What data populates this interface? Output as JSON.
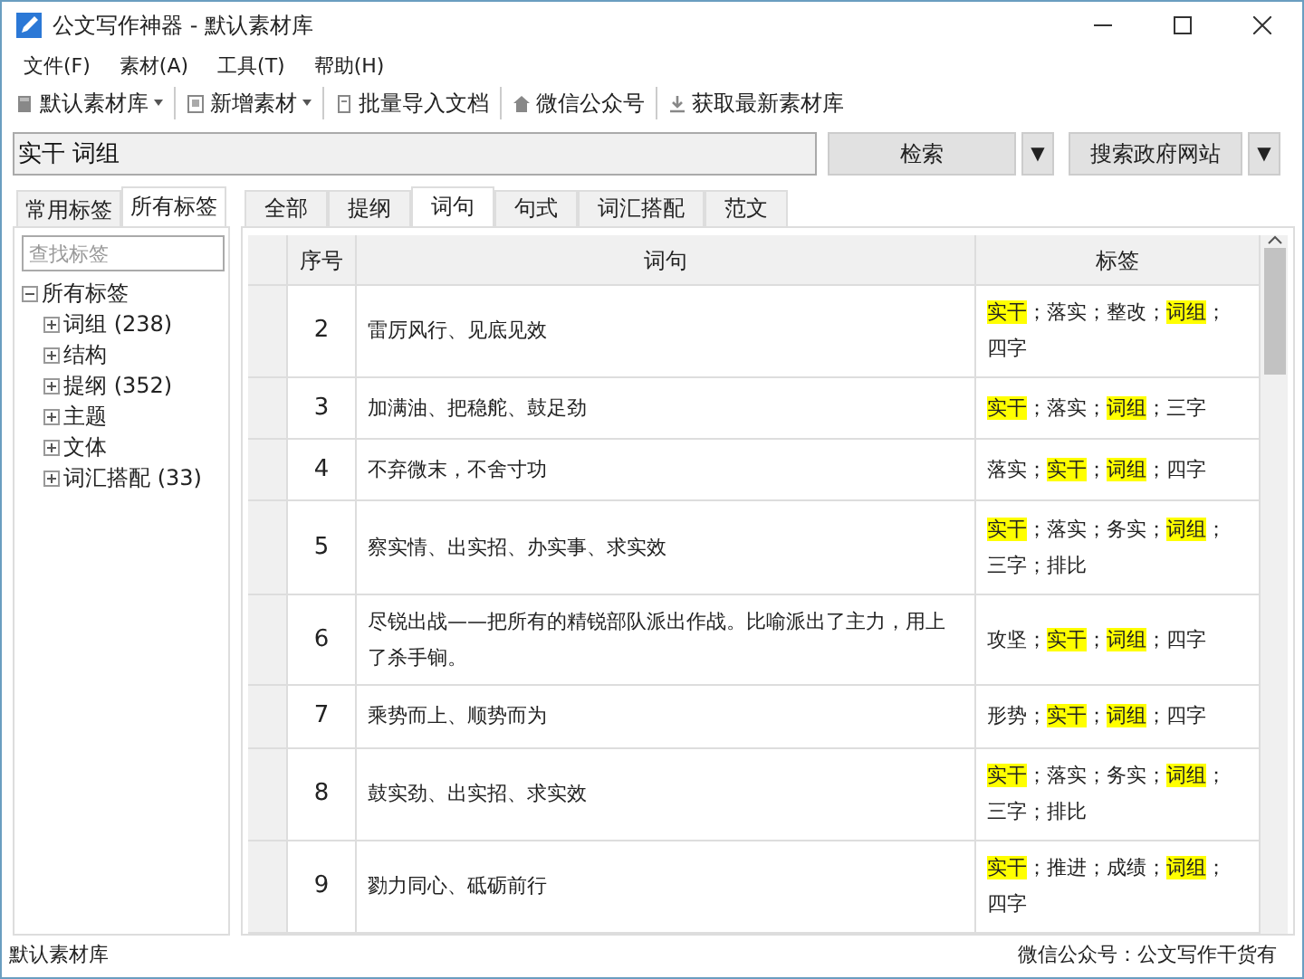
{
  "window": {
    "title": "公文写作神器 - 默认素材库"
  },
  "menu": [
    {
      "label": "文件(F)"
    },
    {
      "label": "素材(A)"
    },
    {
      "label": "工具(T)"
    },
    {
      "label": "帮助(H)"
    }
  ],
  "toolbar": [
    {
      "label": "默认素材库",
      "kind": "library",
      "dropdown": true
    },
    {
      "label": "新增素材",
      "kind": "add",
      "dropdown": true
    },
    {
      "label": "批量导入文档",
      "kind": "import",
      "dropdown": false
    },
    {
      "label": "微信公众号",
      "kind": "home",
      "dropdown": false
    },
    {
      "label": "获取最新素材库",
      "kind": "download",
      "dropdown": false
    }
  ],
  "search": {
    "value": "实干 词组",
    "buttons": [
      {
        "label": "检索",
        "arrow": "▼"
      },
      {
        "label": "搜索政府网站",
        "arrow": "▼"
      }
    ]
  },
  "tag_panel": {
    "tabs": [
      {
        "label": "常用标签",
        "selected": false
      },
      {
        "label": "所有标签",
        "selected": true
      }
    ],
    "filter": {
      "placeholder": "查找标签"
    },
    "tree": {
      "label": "所有标签",
      "expanded": true,
      "children": [
        {
          "label": "词组",
          "count": "(238)",
          "expanded": false
        },
        {
          "label": "结构",
          "expanded": false
        },
        {
          "label": "提纲",
          "count": "(352)",
          "expanded": false
        },
        {
          "label": "主题",
          "expanded": false
        },
        {
          "label": "文体",
          "expanded": false
        },
        {
          "label": "词汇搭配",
          "count": "(33)",
          "expanded": false
        }
      ]
    }
  },
  "content_tabs": [
    {
      "label": "全部",
      "selected": false
    },
    {
      "label": "提纲",
      "selected": false
    },
    {
      "label": "词句",
      "selected": true
    },
    {
      "label": "句式",
      "selected": false
    },
    {
      "label": "词汇搭配",
      "selected": false
    },
    {
      "label": "范文",
      "selected": false
    }
  ],
  "table": {
    "columns": [
      "序号",
      "词句",
      "标签"
    ],
    "separator": "；",
    "rows": [
      {
        "number": "2",
        "text": "雷厉风行、见底见效",
        "tags": [
          {
            "text": "实干",
            "highlighted": true
          },
          {
            "text": "落实",
            "highlighted": false
          },
          {
            "text": "整改",
            "highlighted": false
          },
          {
            "text": "词组",
            "highlighted": true
          },
          {
            "text": "四字",
            "highlighted": false
          }
        ]
      },
      {
        "number": "3",
        "text": "加满油、把稳舵、鼓足劲",
        "tags": [
          {
            "text": "实干",
            "highlighted": true
          },
          {
            "text": "落实",
            "highlighted": false
          },
          {
            "text": "词组",
            "highlighted": true
          },
          {
            "text": "三字",
            "highlighted": false
          }
        ]
      },
      {
        "number": "4",
        "text": "不弃微末，不舍寸功",
        "tags": [
          {
            "text": "落实",
            "highlighted": false
          },
          {
            "text": "实干",
            "highlighted": true
          },
          {
            "text": "词组",
            "highlighted": true
          },
          {
            "text": "四字",
            "highlighted": false
          }
        ]
      },
      {
        "number": "5",
        "text": "察实情、出实招、办实事、求实效",
        "tags": [
          {
            "text": "实干",
            "highlighted": true
          },
          {
            "text": "落实",
            "highlighted": false
          },
          {
            "text": "务实",
            "highlighted": false
          },
          {
            "text": "词组",
            "highlighted": true
          },
          {
            "text": "三字",
            "highlighted": false
          },
          {
            "text": "排比",
            "highlighted": false
          }
        ]
      },
      {
        "number": "6",
        "text": "尽锐出战——把所有的精锐部队派出作战。比喻派出了主力，用上了杀手锏。",
        "tags": [
          {
            "text": "攻坚",
            "highlighted": false
          },
          {
            "text": "实干",
            "highlighted": true
          },
          {
            "text": "词组",
            "highlighted": true
          },
          {
            "text": "四字",
            "highlighted": false
          }
        ]
      },
      {
        "number": "7",
        "text": "乘势而上、顺势而为",
        "tags": [
          {
            "text": "形势",
            "highlighted": false
          },
          {
            "text": "实干",
            "highlighted": true
          },
          {
            "text": "词组",
            "highlighted": true
          },
          {
            "text": "四字",
            "highlighted": false
          }
        ]
      },
      {
        "number": "8",
        "text": "鼓实劲、出实招、求实效",
        "tags": [
          {
            "text": "实干",
            "highlighted": true
          },
          {
            "text": "落实",
            "highlighted": false
          },
          {
            "text": "务实",
            "highlighted": false
          },
          {
            "text": "词组",
            "highlighted": true
          },
          {
            "text": "三字",
            "highlighted": false
          },
          {
            "text": "排比",
            "highlighted": false
          }
        ]
      },
      {
        "number": "9",
        "text": "勠力同心、砥砺前行",
        "tags": [
          {
            "text": "实干",
            "highlighted": true
          },
          {
            "text": "推进",
            "highlighted": false
          },
          {
            "text": "成绩",
            "highlighted": false
          },
          {
            "text": "词组",
            "highlighted": true
          },
          {
            "text": "四字",
            "highlighted": false
          }
        ]
      }
    ]
  },
  "status_bar": {
    "left": "默认素材库",
    "right": "微信公众号：公文写作干货有"
  }
}
